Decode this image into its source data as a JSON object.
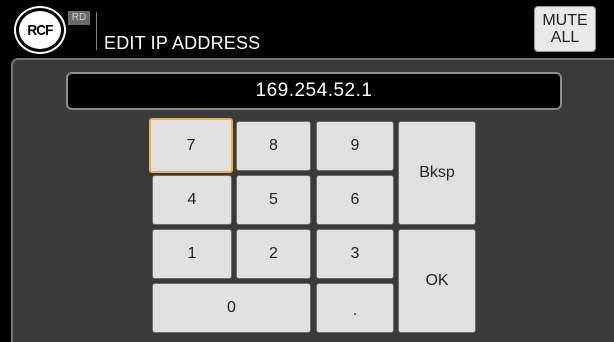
{
  "header": {
    "logo_text": "RCF",
    "badge": "RD",
    "title": "EDIT IP ADDRESS",
    "mute_line1": "MUTE",
    "mute_line2": "ALL"
  },
  "ip_field": {
    "value": "169.254.52.1"
  },
  "keypad": {
    "k7": "7",
    "k8": "8",
    "k9": "9",
    "k4": "4",
    "k5": "5",
    "k6": "6",
    "k1": "1",
    "k2": "2",
    "k3": "3",
    "k0": "0",
    "dot": ".",
    "backspace": "Bksp",
    "ok": "OK",
    "selected_key": "7"
  },
  "colors": {
    "background": "#000000",
    "panel": "#3a3a3a",
    "key": "#e0e0e0",
    "selection": "#f0b040"
  }
}
